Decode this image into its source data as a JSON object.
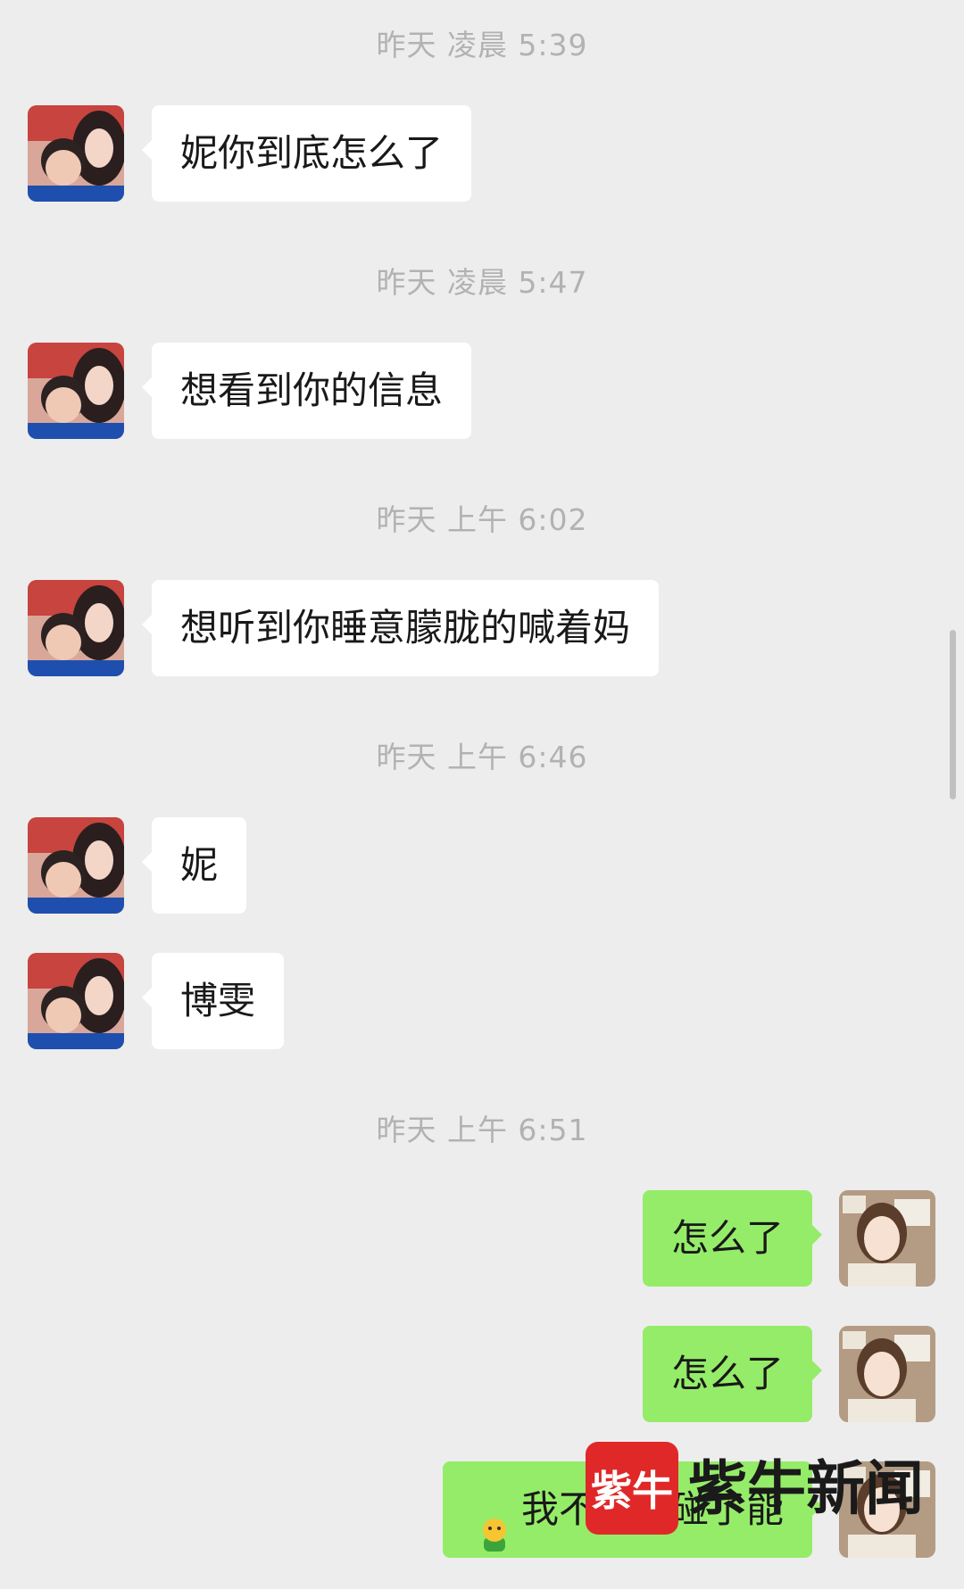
{
  "timestamps": [
    "昨天 凌晨 5:39",
    "昨天 凌晨 5:47",
    "昨天 上午 6:02",
    "昨天 上午 6:46",
    "昨天 上午 6:51"
  ],
  "messages": {
    "in": [
      "妮你到底怎么了",
      "想看到你的信息",
      "想听到你睡意朦胧的喊着妈",
      "妮",
      "博雯"
    ],
    "out": [
      "怎么了",
      "怎么了",
      "我不小心碰了能"
    ]
  },
  "watermark": {
    "badge": "紫牛",
    "text": "紫牛新闻"
  },
  "colors": {
    "background": "#ededed",
    "incoming_bubble": "#ffffff",
    "outgoing_bubble": "#95ec69",
    "timestamp": "#b2b2b2",
    "watermark_red": "#e02828"
  },
  "icons": [
    "avatar-mother-son",
    "avatar-girl",
    "emoji-face"
  ]
}
